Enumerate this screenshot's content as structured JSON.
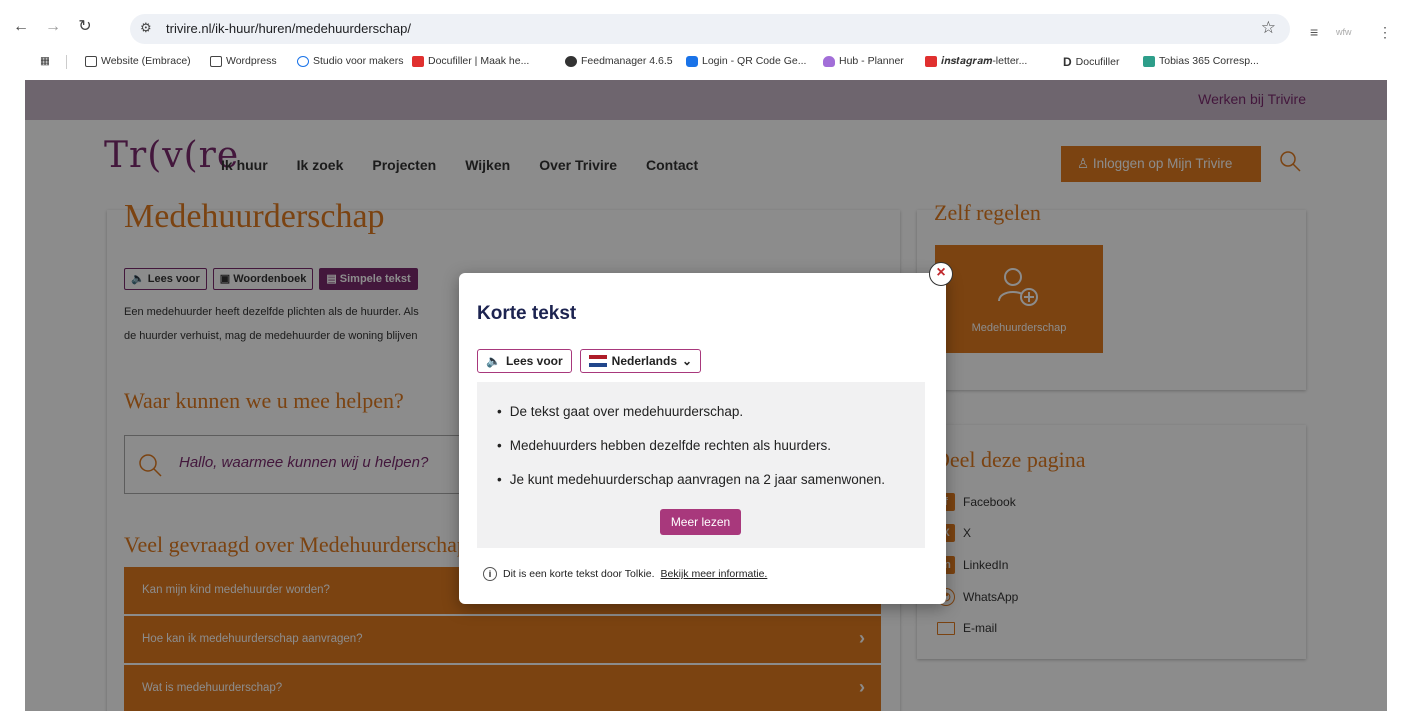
{
  "browser": {
    "url": "trivire.nl/ik-huur/huren/medehuurderschap/",
    "bookmarks": [
      "Website (Embrace)",
      "Wordpress",
      "Studio voor makers",
      "Docufiller | Maak he...",
      "Feedmanager 4.6.5",
      "Login - QR Code Ge...",
      "Hub - Planner",
      "𝒊𝒏𝒔𝒕𝒂𝒈𝒓𝒂𝒎-letter...",
      "Docufiller",
      "Tobias 365 Corresp..."
    ]
  },
  "site": {
    "topbar_link": "Werken bij Trivire",
    "logo": "Tr(v(re",
    "nav": [
      "Ik huur",
      "Ik zoek",
      "Projecten",
      "Wijken",
      "Over Trivire",
      "Contact"
    ],
    "login_label": "Inloggen op Mijn Trivire",
    "page_title": "Medehuurderschap",
    "tools": [
      "Lees voor",
      "Woordenboek",
      "Simpele tekst"
    ],
    "intro_line1": "Een medehuurder heeft dezelfde plichten als de huurder. Als",
    "intro_line2": "de huurder verhuist, mag de medehuurder de woning blijven",
    "help_title": "Waar kunnen we u mee helpen?",
    "search_placeholder": "Hallo, waarmee kunnen wij u helpen?",
    "faq_title": "Veel gevraagd over Medehuurderschap",
    "faq": [
      "Kan mijn kind medehuurder worden?",
      "Hoe kan ik medehuurderschap aanvragen?",
      "Wat is medehuurderschap?"
    ],
    "self_title": "Zelf regelen",
    "tile_label": "Medehuurderschap",
    "share_title": "Deel deze pagina",
    "share": [
      "Facebook",
      "X",
      "LinkedIn",
      "WhatsApp",
      "E-mail"
    ]
  },
  "modal": {
    "title": "Korte tekst",
    "read_aloud": "Lees voor",
    "language": "Nederlands",
    "bullets": [
      "De tekst gaat over medehuurderschap.",
      "Medehuurders hebben dezelfde rechten als huurders.",
      "Je kunt medehuurderschap aanvragen na 2 jaar samenwonen."
    ],
    "more_label": "Meer lezen",
    "footer_text": "Dit is een korte tekst door Tolkie.",
    "footer_link": "Bekijk meer informatie."
  },
  "colors": {
    "brand_orange": "#e07a20",
    "brand_purple": "#7a2a6e",
    "modal_accent": "#a8387c"
  }
}
